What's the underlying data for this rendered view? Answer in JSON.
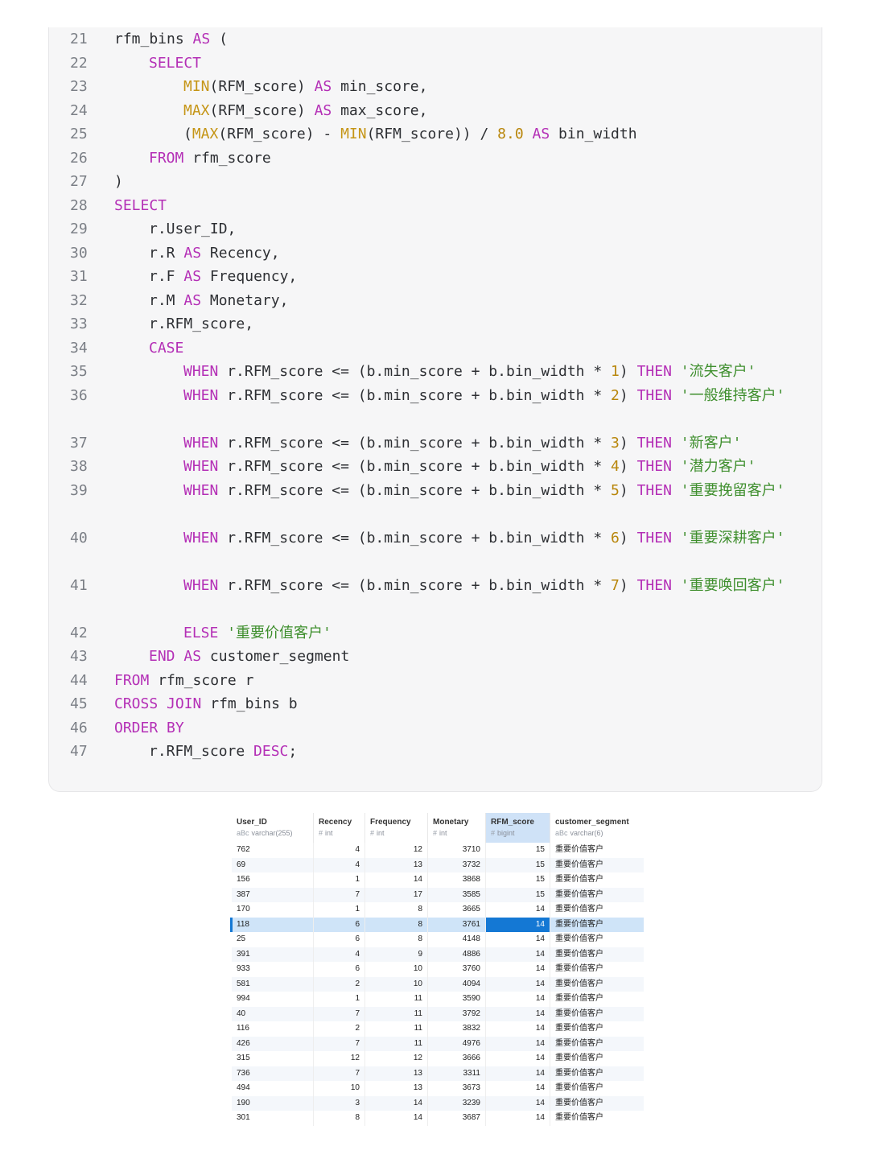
{
  "code": {
    "lines": [
      {
        "n": "21",
        "indent": 0,
        "t": [
          [
            "p",
            "rfm_bins "
          ],
          [
            "k",
            "AS"
          ],
          [
            "p",
            " ("
          ]
        ]
      },
      {
        "n": "22",
        "indent": 1,
        "t": [
          [
            "k",
            "SELECT"
          ]
        ]
      },
      {
        "n": "23",
        "indent": 2,
        "t": [
          [
            "f",
            "MIN"
          ],
          [
            "p",
            "(RFM_score) "
          ],
          [
            "k",
            "AS"
          ],
          [
            "p",
            " min_score,"
          ]
        ]
      },
      {
        "n": "24",
        "indent": 2,
        "t": [
          [
            "f",
            "MAX"
          ],
          [
            "p",
            "(RFM_score) "
          ],
          [
            "k",
            "AS"
          ],
          [
            "p",
            " max_score,"
          ]
        ]
      },
      {
        "n": "25",
        "indent": 2,
        "t": [
          [
            "p",
            "("
          ],
          [
            "f",
            "MAX"
          ],
          [
            "p",
            "(RFM_score) - "
          ],
          [
            "f",
            "MIN"
          ],
          [
            "p",
            "(RFM_score)) / "
          ],
          [
            "n",
            "8.0"
          ],
          [
            "p",
            " "
          ],
          [
            "k",
            "AS"
          ],
          [
            "p",
            " bin_width"
          ]
        ]
      },
      {
        "n": "26",
        "indent": 1,
        "t": [
          [
            "k",
            "FROM"
          ],
          [
            "p",
            " rfm_score"
          ]
        ]
      },
      {
        "n": "27",
        "indent": 0,
        "t": [
          [
            "p",
            ")"
          ]
        ]
      },
      {
        "n": "28",
        "indent": 0,
        "t": [
          [
            "k",
            "SELECT"
          ]
        ]
      },
      {
        "n": "29",
        "indent": 1,
        "t": [
          [
            "p",
            "r.User_ID,"
          ]
        ]
      },
      {
        "n": "30",
        "indent": 1,
        "t": [
          [
            "p",
            "r.R "
          ],
          [
            "k",
            "AS"
          ],
          [
            "p",
            " Recency,"
          ]
        ]
      },
      {
        "n": "31",
        "indent": 1,
        "t": [
          [
            "p",
            "r.F "
          ],
          [
            "k",
            "AS"
          ],
          [
            "p",
            " Frequency,"
          ]
        ]
      },
      {
        "n": "32",
        "indent": 1,
        "t": [
          [
            "p",
            "r.M "
          ],
          [
            "k",
            "AS"
          ],
          [
            "p",
            " Monetary,"
          ]
        ]
      },
      {
        "n": "33",
        "indent": 1,
        "t": [
          [
            "p",
            "r.RFM_score,"
          ]
        ]
      },
      {
        "n": "34",
        "indent": 1,
        "t": [
          [
            "k",
            "CASE"
          ]
        ]
      },
      {
        "n": "35",
        "indent": 2,
        "t": [
          [
            "k",
            "WHEN"
          ],
          [
            "p",
            " r.RFM_score <= (b.min_score + b.bin_width * "
          ],
          [
            "n",
            "1"
          ],
          [
            "p",
            ") "
          ],
          [
            "k",
            "THEN"
          ],
          [
            "p",
            " "
          ],
          [
            "s",
            "'流失客户'"
          ]
        ]
      },
      {
        "n": "36",
        "indent": 2,
        "t": [
          [
            "k",
            "WHEN"
          ],
          [
            "p",
            " r.RFM_score <= (b.min_score + b.bin_width * "
          ],
          [
            "n",
            "2"
          ],
          [
            "p",
            ") "
          ],
          [
            "k",
            "THEN"
          ],
          [
            "p",
            " "
          ],
          [
            "s",
            "'一般维持客户'"
          ]
        ]
      },
      {
        "n": "37",
        "indent": 2,
        "gap": true,
        "t": [
          [
            "k",
            "WHEN"
          ],
          [
            "p",
            " r.RFM_score <= (b.min_score + b.bin_width * "
          ],
          [
            "n",
            "3"
          ],
          [
            "p",
            ") "
          ],
          [
            "k",
            "THEN"
          ],
          [
            "p",
            " "
          ],
          [
            "s",
            "'新客户'"
          ]
        ]
      },
      {
        "n": "38",
        "indent": 2,
        "t": [
          [
            "k",
            "WHEN"
          ],
          [
            "p",
            " r.RFM_score <= (b.min_score + b.bin_width * "
          ],
          [
            "n",
            "4"
          ],
          [
            "p",
            ") "
          ],
          [
            "k",
            "THEN"
          ],
          [
            "p",
            " "
          ],
          [
            "s",
            "'潜力客户'"
          ]
        ]
      },
      {
        "n": "39",
        "indent": 2,
        "t": [
          [
            "k",
            "WHEN"
          ],
          [
            "p",
            " r.RFM_score <= (b.min_score + b.bin_width * "
          ],
          [
            "n",
            "5"
          ],
          [
            "p",
            ") "
          ],
          [
            "k",
            "THEN"
          ],
          [
            "p",
            " "
          ],
          [
            "s",
            "'重要挽留客户'"
          ]
        ]
      },
      {
        "n": "40",
        "indent": 2,
        "gap": true,
        "t": [
          [
            "k",
            "WHEN"
          ],
          [
            "p",
            " r.RFM_score <= (b.min_score + b.bin_width * "
          ],
          [
            "n",
            "6"
          ],
          [
            "p",
            ") "
          ],
          [
            "k",
            "THEN"
          ],
          [
            "p",
            " "
          ],
          [
            "s",
            "'重要深耕客户'"
          ]
        ]
      },
      {
        "n": "41",
        "indent": 2,
        "gap": true,
        "t": [
          [
            "k",
            "WHEN"
          ],
          [
            "p",
            " r.RFM_score <= (b.min_score + b.bin_width * "
          ],
          [
            "n",
            "7"
          ],
          [
            "p",
            ") "
          ],
          [
            "k",
            "THEN"
          ],
          [
            "p",
            " "
          ],
          [
            "s",
            "'重要唤回客户'"
          ]
        ]
      },
      {
        "n": "42",
        "indent": 2,
        "gap": true,
        "t": [
          [
            "k",
            "ELSE"
          ],
          [
            "p",
            " "
          ],
          [
            "s",
            "'重要价值客户'"
          ]
        ]
      },
      {
        "n": "43",
        "indent": 1,
        "t": [
          [
            "k",
            "END"
          ],
          [
            "p",
            " "
          ],
          [
            "k",
            "AS"
          ],
          [
            "p",
            " customer_segment"
          ]
        ]
      },
      {
        "n": "44",
        "indent": 0,
        "t": [
          [
            "k",
            "FROM"
          ],
          [
            "p",
            " rfm_score r"
          ]
        ]
      },
      {
        "n": "45",
        "indent": 0,
        "t": [
          [
            "k",
            "CROSS"
          ],
          [
            "p",
            " "
          ],
          [
            "k",
            "JOIN"
          ],
          [
            "p",
            " rfm_bins b"
          ]
        ]
      },
      {
        "n": "46",
        "indent": 0,
        "t": [
          [
            "k",
            "ORDER"
          ],
          [
            "p",
            " "
          ],
          [
            "k",
            "BY"
          ]
        ]
      },
      {
        "n": "47",
        "indent": 1,
        "t": [
          [
            "p",
            "r.RFM_score "
          ],
          [
            "k",
            "DESC"
          ],
          [
            "p",
            ";"
          ]
        ]
      }
    ]
  },
  "grid": {
    "columns": [
      {
        "name": "User_ID",
        "icon": "abc-icon",
        "icon_text": "aBc",
        "type": "varchar(255)"
      },
      {
        "name": "Recency",
        "icon": "hash-icon",
        "icon_text": "#",
        "type": "int"
      },
      {
        "name": "Frequency",
        "icon": "hash-icon",
        "icon_text": "#",
        "type": "int"
      },
      {
        "name": "Monetary",
        "icon": "hash-icon",
        "icon_text": "#",
        "type": "int"
      },
      {
        "name": "RFM_score",
        "icon": "hash-icon",
        "icon_text": "#",
        "type": "bigint",
        "selected": true
      },
      {
        "name": "customer_segment",
        "icon": "abc-icon",
        "icon_text": "aBc",
        "type": "varchar(6)"
      }
    ],
    "active_row": 5,
    "rows": [
      [
        "762",
        "4",
        "12",
        "3710",
        "15",
        "重要价值客户"
      ],
      [
        "69",
        "4",
        "13",
        "3732",
        "15",
        "重要价值客户"
      ],
      [
        "156",
        "1",
        "14",
        "3868",
        "15",
        "重要价值客户"
      ],
      [
        "387",
        "7",
        "17",
        "3585",
        "15",
        "重要价值客户"
      ],
      [
        "170",
        "1",
        "8",
        "3665",
        "14",
        "重要价值客户"
      ],
      [
        "118",
        "6",
        "8",
        "3761",
        "14",
        "重要价值客户"
      ],
      [
        "25",
        "6",
        "8",
        "4148",
        "14",
        "重要价值客户"
      ],
      [
        "391",
        "4",
        "9",
        "4886",
        "14",
        "重要价值客户"
      ],
      [
        "933",
        "6",
        "10",
        "3760",
        "14",
        "重要价值客户"
      ],
      [
        "581",
        "2",
        "10",
        "4094",
        "14",
        "重要价值客户"
      ],
      [
        "994",
        "1",
        "11",
        "3590",
        "14",
        "重要价值客户"
      ],
      [
        "40",
        "7",
        "11",
        "3792",
        "14",
        "重要价值客户"
      ],
      [
        "116",
        "2",
        "11",
        "3832",
        "14",
        "重要价值客户"
      ],
      [
        "426",
        "7",
        "11",
        "4976",
        "14",
        "重要价值客户"
      ],
      [
        "315",
        "12",
        "12",
        "3666",
        "14",
        "重要价值客户"
      ],
      [
        "736",
        "7",
        "13",
        "3311",
        "14",
        "重要价值客户"
      ],
      [
        "494",
        "10",
        "13",
        "3673",
        "14",
        "重要价值客户"
      ],
      [
        "190",
        "3",
        "14",
        "3239",
        "14",
        "重要价值客户"
      ],
      [
        "301",
        "8",
        "14",
        "3687",
        "14",
        "重要价值客户"
      ]
    ]
  }
}
